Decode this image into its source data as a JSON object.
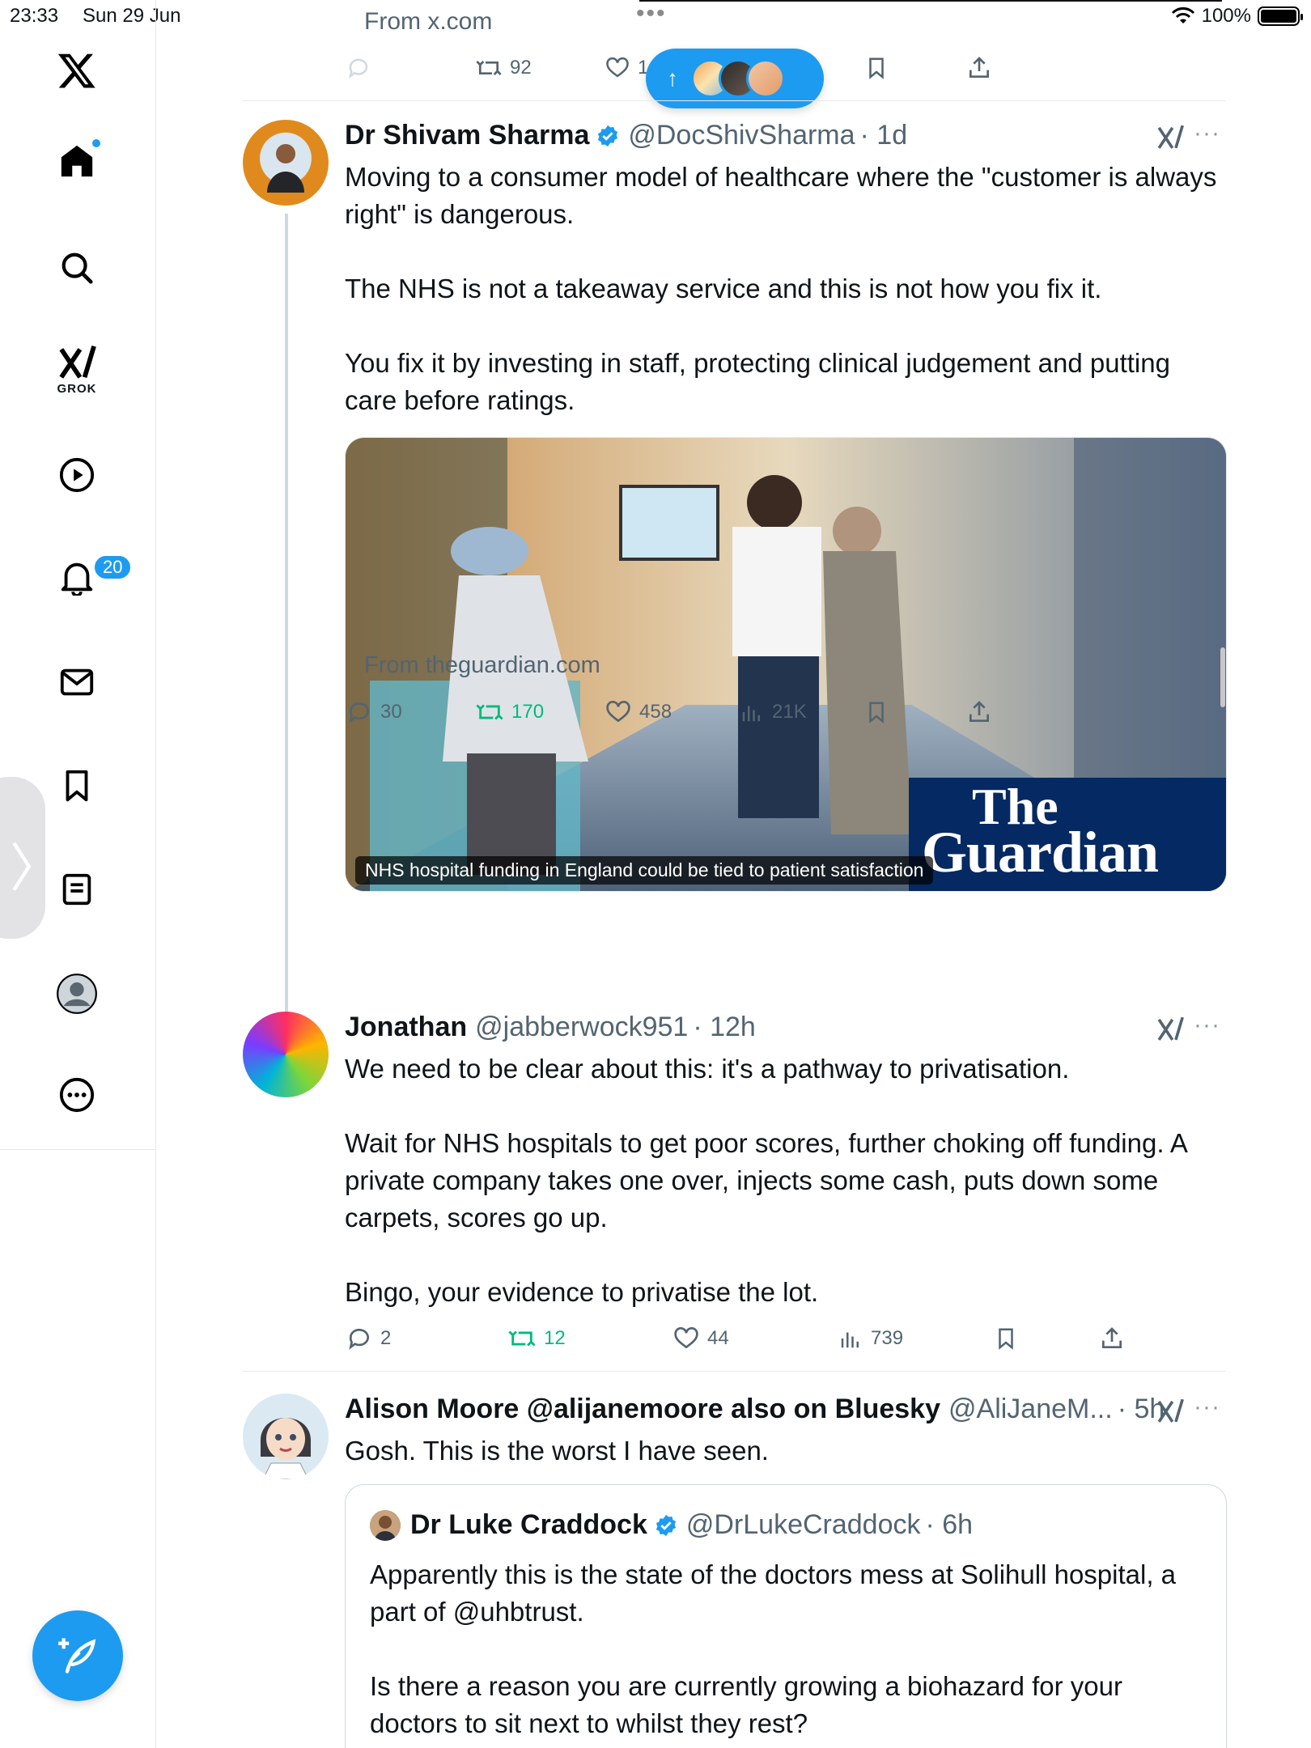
{
  "status_bar": {
    "time": "23:33",
    "date": "Sun 29 Jun",
    "battery": "100%"
  },
  "sidebar": {
    "items": [
      {
        "name": "x-logo"
      },
      {
        "name": "home"
      },
      {
        "name": "search"
      },
      {
        "name": "grok",
        "label": "GROK"
      },
      {
        "name": "video"
      },
      {
        "name": "notifications",
        "badge": "20"
      },
      {
        "name": "messages"
      },
      {
        "name": "bookmarks"
      },
      {
        "name": "articles"
      },
      {
        "name": "profile"
      },
      {
        "name": "more"
      }
    ]
  },
  "prev_tweet": {
    "from_link": "From x.com",
    "retweets": "92",
    "likes": "1"
  },
  "new_posts_pill": {
    "arrow": "↑"
  },
  "tweets": [
    {
      "name": "Dr Shivam Sharma",
      "handle": "@DocShivSharma",
      "time": "· 1d",
      "paragraphs": [
        "Moving to a consumer model of healthcare where the \"customer is always right\" is dangerous.",
        "The NHS is not a takeaway service and this is not how you fix it.",
        "You fix it by investing in staff, protecting clinical judgement and putting care before ratings."
      ],
      "media_caption": "NHS hospital funding in England could be tied to patient satisfaction",
      "media_logo_line1": "The",
      "media_logo_line2": "Guardian",
      "from_link": "From theguardian.com",
      "replies": "30",
      "retweets": "170",
      "likes": "458",
      "views": "21K"
    },
    {
      "name": "Jonathan",
      "handle": "@jabberwock951",
      "time": "· 12h",
      "paragraphs": [
        "We need to be clear about this: it's a pathway to privatisation.",
        "Wait for NHS hospitals to get poor scores, further choking off funding. A private company takes one over, injects some cash, puts down some carpets, scores go up.",
        "Bingo, your evidence to privatise the lot."
      ],
      "replies": "2",
      "retweets": "12",
      "likes": "44",
      "views": "739"
    },
    {
      "name": "Alison Moore @alijanemoore also on Bluesky",
      "handle": "@AliJaneM...",
      "time": "· 5h",
      "paragraphs": [
        "Gosh. This is the worst I have seen."
      ],
      "quote": {
        "name": "Dr Luke Craddock",
        "handle": "@DrLukeCraddock",
        "time": "· 6h",
        "paragraphs": [
          "Apparently this is the state of the doctors mess at Solihull hospital, a part of @uhbtrust.",
          "Is there a reason you are currently growing a biohazard for your doctors to sit next to whilst they rest?"
        ]
      }
    }
  ],
  "colors": {
    "accent": "#1d9bf0",
    "retweet_green": "#00ba7c",
    "muted": "#536471",
    "guardian_blue": "#052962"
  }
}
